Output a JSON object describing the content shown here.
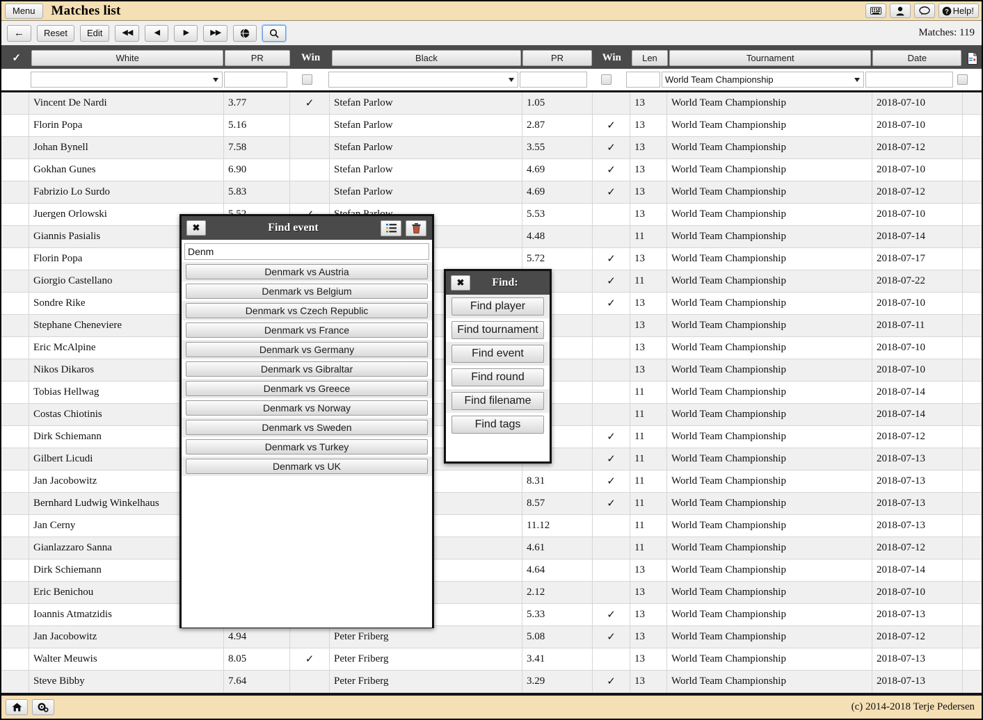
{
  "window": {
    "menu_label": "Menu",
    "title": "Matches list",
    "help_label": "Help!",
    "title_icons": [
      "keyboard-icon",
      "user-icon",
      "comment-icon"
    ]
  },
  "toolbar": {
    "back_label": "←",
    "reset_label": "Reset",
    "edit_label": "Edit",
    "first_label": "◀◀",
    "prev_label": "◀",
    "next_label": "▶",
    "last_label": "▶▶",
    "globe_label": "globe-icon",
    "search_label": "search-icon",
    "matches_count": "Matches: 119"
  },
  "columns": {
    "select": "✓",
    "white": "White",
    "white_pr": "PR",
    "white_win": "Win",
    "black": "Black",
    "black_pr": "PR",
    "black_win": "Win",
    "len": "Len",
    "tournament": "Tournament",
    "date": "Date",
    "export": "export-file-icon"
  },
  "filters": {
    "white": "",
    "white_placeholder": "",
    "white_pr": "",
    "white_win_checked": false,
    "black": "",
    "black_pr": "",
    "black_win_checked": false,
    "len": "",
    "tournament": "World Team Championship",
    "date": "",
    "export_checked": false
  },
  "rows": [
    {
      "white": "Vincent De Nardi",
      "white_pr": "3.77",
      "white_win": "✓",
      "black": "Stefan Parlow",
      "black_pr": "1.05",
      "black_win": "",
      "len": "13",
      "tournament": "World Team Championship",
      "date": "2018-07-10"
    },
    {
      "white": "Florin Popa",
      "white_pr": "5.16",
      "white_win": "",
      "black": "Stefan Parlow",
      "black_pr": "2.87",
      "black_win": "✓",
      "len": "13",
      "tournament": "World Team Championship",
      "date": "2018-07-10"
    },
    {
      "white": "Johan Bynell",
      "white_pr": "7.58",
      "white_win": "",
      "black": "Stefan Parlow",
      "black_pr": "3.55",
      "black_win": "✓",
      "len": "13",
      "tournament": "World Team Championship",
      "date": "2018-07-12"
    },
    {
      "white": "Gokhan Gunes",
      "white_pr": "6.90",
      "white_win": "",
      "black": "Stefan Parlow",
      "black_pr": "4.69",
      "black_win": "✓",
      "len": "13",
      "tournament": "World Team Championship",
      "date": "2018-07-10"
    },
    {
      "white": "Fabrizio Lo Surdo",
      "white_pr": "5.83",
      "white_win": "",
      "black": "Stefan Parlow",
      "black_pr": "4.69",
      "black_win": "✓",
      "len": "13",
      "tournament": "World Team Championship",
      "date": "2018-07-12"
    },
    {
      "white": "Juergen Orlowski",
      "white_pr": "5.52",
      "white_win": "✓",
      "black": "Stefan Parlow",
      "black_pr": "5.53",
      "black_win": "",
      "len": "13",
      "tournament": "World Team Championship",
      "date": "2018-07-10"
    },
    {
      "white": "Giannis Pasialis",
      "white_pr": "",
      "white_win": "",
      "black": "",
      "black_pr": "4.48",
      "black_win": "",
      "len": "11",
      "tournament": "World Team Championship",
      "date": "2018-07-14"
    },
    {
      "white": "Florin Popa",
      "white_pr": "",
      "white_win": "",
      "black": "",
      "black_pr": "5.72",
      "black_win": "✓",
      "len": "13",
      "tournament": "World Team Championship",
      "date": "2018-07-17"
    },
    {
      "white": "Giorgio Castellano",
      "white_pr": "",
      "white_win": "",
      "black": "",
      "black_pr": "",
      "black_win": "✓",
      "len": "11",
      "tournament": "World Team Championship",
      "date": "2018-07-22"
    },
    {
      "white": "Sondre Rike",
      "white_pr": "",
      "white_win": "",
      "black": "",
      "black_pr": "",
      "black_win": "✓",
      "len": "13",
      "tournament": "World Team Championship",
      "date": "2018-07-10"
    },
    {
      "white": "Stephane Cheneviere",
      "white_pr": "",
      "white_win": "",
      "black": "",
      "black_pr": "",
      "black_win": "",
      "len": "13",
      "tournament": "World Team Championship",
      "date": "2018-07-11"
    },
    {
      "white": "Eric McAlpine",
      "white_pr": "",
      "white_win": "",
      "black": "",
      "black_pr": "",
      "black_win": "",
      "len": "13",
      "tournament": "World Team Championship",
      "date": "2018-07-10"
    },
    {
      "white": "Nikos Dikaros",
      "white_pr": "",
      "white_win": "",
      "black": "",
      "black_pr": "",
      "black_win": "",
      "len": "13",
      "tournament": "World Team Championship",
      "date": "2018-07-10"
    },
    {
      "white": "Tobias Hellwag",
      "white_pr": "",
      "white_win": "",
      "black": "",
      "black_pr": "",
      "black_win": "",
      "len": "11",
      "tournament": "World Team Championship",
      "date": "2018-07-14"
    },
    {
      "white": "Costas Chiotinis",
      "white_pr": "",
      "white_win": "",
      "black": "",
      "black_pr": "",
      "black_win": "",
      "len": "11",
      "tournament": "World Team Championship",
      "date": "2018-07-14"
    },
    {
      "white": "Dirk Schiemann",
      "white_pr": "",
      "white_win": "",
      "black": "",
      "black_pr": "",
      "black_win": "✓",
      "len": "11",
      "tournament": "World Team Championship",
      "date": "2018-07-12"
    },
    {
      "white": "Gilbert Licudi",
      "white_pr": "",
      "white_win": "",
      "black": "",
      "black_pr": "",
      "black_win": "✓",
      "len": "11",
      "tournament": "World Team Championship",
      "date": "2018-07-13"
    },
    {
      "white": "Jan Jacobowitz",
      "white_pr": "",
      "white_win": "",
      "black": "",
      "black_pr": "8.31",
      "black_win": "✓",
      "len": "11",
      "tournament": "World Team Championship",
      "date": "2018-07-13"
    },
    {
      "white": "Bernhard Ludwig Winkelhaus",
      "white_pr": "",
      "white_win": "",
      "black": "",
      "black_pr": "8.57",
      "black_win": "✓",
      "len": "11",
      "tournament": "World Team Championship",
      "date": "2018-07-13"
    },
    {
      "white": "Jan Cerny",
      "white_pr": "",
      "white_win": "",
      "black": "",
      "black_pr": "11.12",
      "black_win": "",
      "len": "11",
      "tournament": "World Team Championship",
      "date": "2018-07-13"
    },
    {
      "white": "Gianlazzaro Sanna",
      "white_pr": "",
      "white_win": "",
      "black": "",
      "black_pr": "4.61",
      "black_win": "",
      "len": "11",
      "tournament": "World Team Championship",
      "date": "2018-07-12"
    },
    {
      "white": "Dirk Schiemann",
      "white_pr": "",
      "white_win": "",
      "black": "",
      "black_pr": "4.64",
      "black_win": "",
      "len": "13",
      "tournament": "World Team Championship",
      "date": "2018-07-14"
    },
    {
      "white": "Eric Benichou",
      "white_pr": "",
      "white_win": "",
      "black": "",
      "black_pr": "2.12",
      "black_win": "",
      "len": "13",
      "tournament": "World Team Championship",
      "date": "2018-07-10"
    },
    {
      "white": "Ioannis Atmatzidis",
      "white_pr": "",
      "white_win": "",
      "black": "",
      "black_pr": "5.33",
      "black_win": "✓",
      "len": "13",
      "tournament": "World Team Championship",
      "date": "2018-07-13"
    },
    {
      "white": "Jan Jacobowitz",
      "white_pr": "4.94",
      "white_win": "",
      "black": "Peter Friberg",
      "black_pr": "5.08",
      "black_win": "✓",
      "len": "13",
      "tournament": "World Team Championship",
      "date": "2018-07-12"
    },
    {
      "white": "Walter Meuwis",
      "white_pr": "8.05",
      "white_win": "✓",
      "black": "Peter Friberg",
      "black_pr": "3.41",
      "black_win": "",
      "len": "13",
      "tournament": "World Team Championship",
      "date": "2018-07-13"
    },
    {
      "white": "Steve Bibby",
      "white_pr": "7.64",
      "white_win": "",
      "black": "Peter Friberg",
      "black_pr": "3.29",
      "black_win": "✓",
      "len": "13",
      "tournament": "World Team Championship",
      "date": "2018-07-13"
    }
  ],
  "find_event_dialog": {
    "title": "Find event",
    "close_label": "✖",
    "list_icon": "list-icon",
    "trash_icon": "trash-icon",
    "search_value": "Denm",
    "search_placeholder": "",
    "results": [
      "Denmark vs Austria",
      "Denmark vs Belgium",
      "Denmark vs Czech Republic",
      "Denmark vs France",
      "Denmark vs Germany",
      "Denmark vs Gibraltar",
      "Denmark vs Greece",
      "Denmark vs Norway",
      "Denmark vs Sweden",
      "Denmark vs Turkey",
      "Denmark vs UK"
    ]
  },
  "find_menu_dialog": {
    "title": "Find:",
    "close_label": "✖",
    "items": [
      "Find player",
      "Find tournament",
      "Find event",
      "Find round",
      "Find filename",
      "Find tags"
    ]
  },
  "bottombar": {
    "home_icon": "home-icon",
    "settings_icon": "gears-icon",
    "copyright": "(c) 2014-2018 Terje Pedersen"
  }
}
